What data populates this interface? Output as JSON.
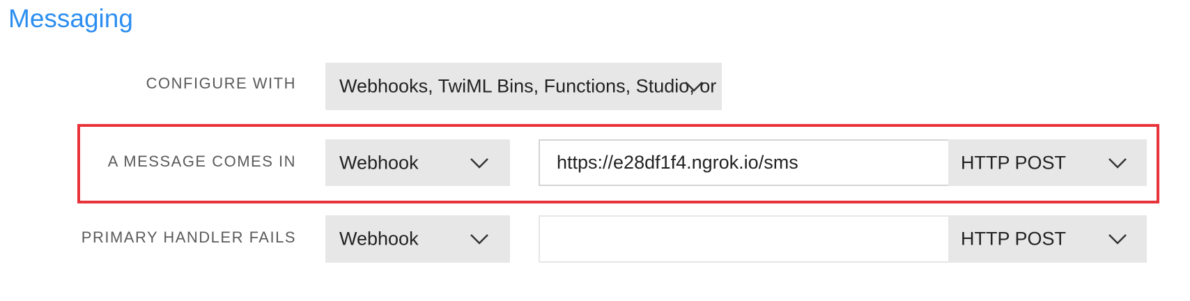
{
  "section": {
    "title": "Messaging"
  },
  "configure_with": {
    "label": "CONFIGURE WITH",
    "selected": "Webhooks, TwiML Bins, Functions, Studio, or Proxy"
  },
  "message_comes_in": {
    "label": "A MESSAGE COMES IN",
    "type_selected": "Webhook",
    "url_value": "https://e28df1f4.ngrok.io/sms",
    "method_selected": "HTTP POST"
  },
  "primary_handler_fails": {
    "label": "PRIMARY HANDLER FAILS",
    "type_selected": "Webhook",
    "url_value": "",
    "method_selected": "HTTP POST"
  },
  "colors": {
    "title": "#2b8ef0",
    "highlight": "#e8333a",
    "select_bg": "#e7e7e7"
  },
  "icons": {
    "dropdown": "chevron-down-icon"
  }
}
